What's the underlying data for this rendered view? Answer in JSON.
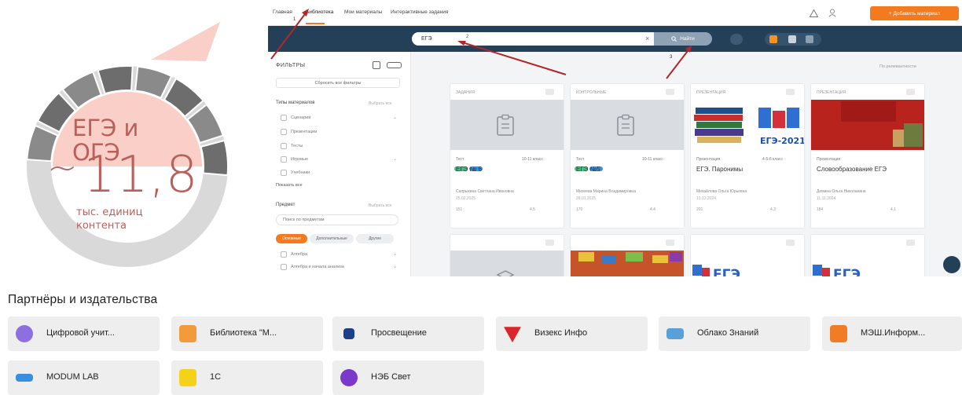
{
  "infographic": {
    "label": "ЕГЭ и ОГЭ",
    "approx": "~",
    "number": "11,8",
    "units": "тыс. единиц контента"
  },
  "screenshot": {
    "nav": {
      "tabs": [
        "Главная",
        "Библиотека",
        "Мои материалы",
        "Интерактивные задания"
      ],
      "active_tab": "Библиотека",
      "add_button": "+ Добавить материал"
    },
    "search": {
      "value": "ЕГЭ",
      "clear": "×",
      "button": "Найти"
    },
    "filters": {
      "title": "ФИЛЬТРЫ",
      "reset": "Сбросить все фильтры",
      "types_heading": "Типы материалов",
      "types_all": "Выбрать все",
      "types": [
        "Сценарии",
        "Презентации",
        "Тесты",
        "Игровые",
        "Учебники"
      ],
      "show_all": "Показать все",
      "subject_heading": "Предмет",
      "subject_hint": "Выбрать все",
      "subject_placeholder": "Поиск по предметам",
      "subject_tabs": [
        "Основные",
        "Дополнительные",
        "Другие"
      ],
      "subjects": [
        "Алгебра",
        "Алгебра и начала анализа"
      ]
    },
    "sort": "По релевантности",
    "cards": [
      {
        "type": "ЗАДАНИЯ",
        "kind": "Тест",
        "grade": "10-11 класс",
        "title": "ЕГЭ № 6",
        "author": "Сапрыкина Светлана Ивановна",
        "date": "25.02.2025",
        "views": "151",
        "rating": "4.5"
      },
      {
        "type": "КОНТРОЛЬНЫЕ",
        "kind": "Тест",
        "grade": "10-11 класс",
        "title": "ЕГЭ №5",
        "author": "Михеева Марина Владимировна",
        "date": "28.01.2025",
        "views": "170",
        "rating": "4.4"
      },
      {
        "type": "ПРЕЗЕНТАЦИЯ",
        "kind": "Презентация",
        "grade": "4-5-6 класс",
        "title": "ЕГЭ. Паронимы",
        "author": "Михайлова Ольга Юрьевна",
        "date": "13.12.2024",
        "views": "201",
        "rating": "4.3"
      },
      {
        "type": "ПРЕЗЕНТАЦИЯ",
        "kind": "Презентация",
        "grade": "",
        "title": "Словообразование ЕГЭ",
        "author": "Демина Ольга Николаевна",
        "date": "11.11.2024",
        "views": "184",
        "rating": "4.1"
      }
    ],
    "step_markers": [
      "1",
      "2",
      "3"
    ]
  },
  "partners": {
    "title": "Партнёры и издательства",
    "items": [
      {
        "name": "Цифровой учит...",
        "color": "#8d6fe0"
      },
      {
        "name": "Библиотека \"М...",
        "color": "#f29a3c"
      },
      {
        "name": "Просвещение",
        "color": "#1c3f8c"
      },
      {
        "name": "Визекс Инфо",
        "color": "#d8262b"
      },
      {
        "name": "Облако Знаний",
        "color": "#5aa0d8"
      },
      {
        "name": "МЭШ.Информ...",
        "color": "#f07d26"
      },
      {
        "name": "MODUM LAB",
        "color": "#3a8ee0"
      },
      {
        "name": "1С",
        "color": "#f5d21a"
      },
      {
        "name": "НЭБ Свет",
        "color": "#7a39c9"
      }
    ]
  },
  "colors": {
    "accent": "#f37a1f",
    "search_bar": "#243f58",
    "ring_light": "#d9d9d9",
    "ring_dark": "#6d6d6d",
    "ring_text": "#b9605c",
    "ring_fill": "#f9cfc7"
  }
}
